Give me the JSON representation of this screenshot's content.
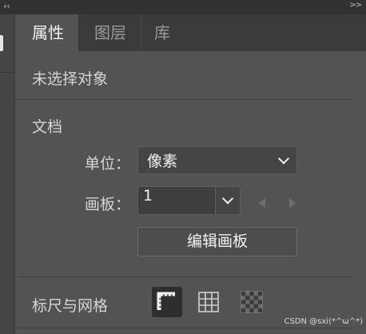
{
  "titlebar": {
    "collapse_left_icon": "double-chevron-left-icon",
    "collapse_right_text": ">>"
  },
  "tabs": [
    {
      "label": "属性",
      "active": true
    },
    {
      "label": "图层",
      "active": false
    },
    {
      "label": "库",
      "active": false
    }
  ],
  "selection_status": "未选择对象",
  "document": {
    "section_title": "文档",
    "units_label": "单位：",
    "units_value": "像素",
    "artboard_label": "画板：",
    "artboard_value": "1",
    "edit_artboards_button": "编辑画板"
  },
  "rulers_grids": {
    "label": "标尺与网格",
    "icons": [
      "ruler-icon",
      "grid-icon",
      "transparency-grid-icon"
    ],
    "active_icon": "ruler-icon"
  },
  "watermark": "CSDN @sxi(*^ω^*)"
}
